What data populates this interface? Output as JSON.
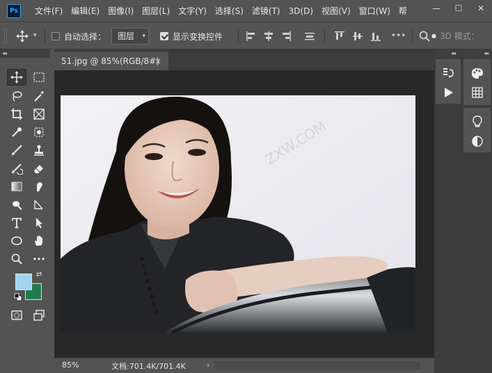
{
  "app": {
    "logo": "Ps"
  },
  "menu": [
    "文件(F)",
    "编辑(E)",
    "图像(I)",
    "图层(L)",
    "文字(Y)",
    "选择(S)",
    "滤镜(T)",
    "3D(D)",
    "视图(V)",
    "窗口(W)",
    "帮"
  ],
  "window_controls": {
    "minimize": "—",
    "maximize": "☐",
    "close": "✕"
  },
  "options": {
    "auto_select_label": "自动选择：",
    "auto_select_checked": false,
    "layer_select_value": "图层",
    "show_transform_label": "显示变换控件",
    "show_transform_checked": true,
    "mode_3d_label": "3D 模式："
  },
  "panel_collapse_glyph": "◂◂",
  "document": {
    "tab_title": "51.jpg @ 85%(RGB/8#)",
    "tab_close": "×",
    "watermark": "ZXW.COM"
  },
  "status": {
    "zoom": "85%",
    "doc_info": "文档:701.4K/701.4K",
    "arrow": "›"
  },
  "colors": {
    "foreground": "#a3d3f0",
    "background": "#1f7a4c",
    "ui_panel": "#535353",
    "ui_dark": "#3c3c3c",
    "canvas": "#282828",
    "ps_accent": "#31a8ff"
  },
  "icons": {
    "toolbar": [
      "move-icon",
      "marquee-icon",
      "lasso-icon",
      "magic-wand-icon",
      "crop-icon",
      "frame-icon",
      "eyedropper-icon",
      "spot-healing-icon",
      "brush-icon",
      "stamp-icon",
      "history-brush-icon",
      "eraser-icon",
      "gradient-icon",
      "smudge-icon",
      "dodge-icon",
      "pen-icon",
      "type-icon",
      "path-select-icon",
      "ellipse-icon",
      "hand-icon",
      "zoom-icon",
      "more-icon",
      "quick-mask-icon",
      "screen-mode-icon"
    ],
    "panels": [
      "history-icon",
      "actions-play-icon",
      "color-icon",
      "swatches-icon",
      "learn-icon",
      "adjustments-icon"
    ]
  }
}
